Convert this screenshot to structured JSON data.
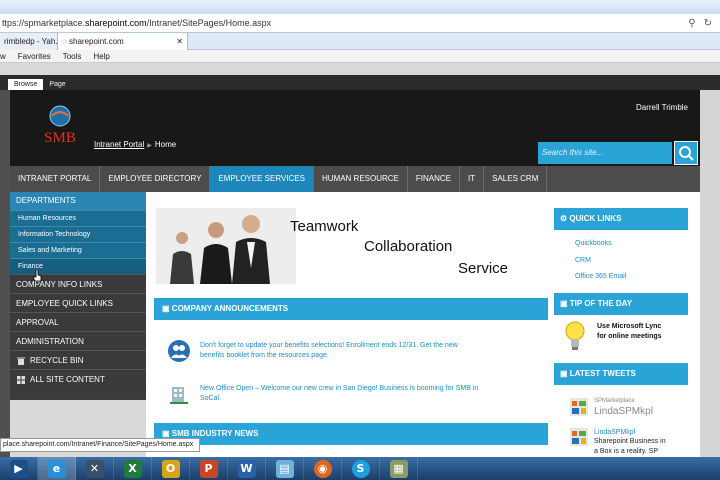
{
  "browser": {
    "url_prefix": "ttps://spmarketplace.",
    "url_domain": "sharepoint.com",
    "url_path": "/Intranet/SitePages/Home.aspx",
    "tabs": [
      {
        "label": "rimbledp - Yah..."
      },
      {
        "label": "sharepoint.com"
      }
    ],
    "menu": [
      "w",
      "Favorites",
      "Tools",
      "Help"
    ],
    "status_url": "place.sharepoint.com/Intranet/Finance/SitePages/Home.aspx"
  },
  "ribbon": {
    "tabs": [
      "Browse",
      "Page"
    ],
    "active": "Browse"
  },
  "header": {
    "user_name": "Darrell Trimble",
    "logo_text": "SMB",
    "breadcrumb": [
      "Intranet Portal",
      "Home"
    ],
    "search_placeholder": "Search this site..."
  },
  "top_nav": [
    {
      "label": "INTRANET PORTAL"
    },
    {
      "label": "EMPLOYEE DIRECTORY"
    },
    {
      "label": "EMPLOYEE SERVICES"
    },
    {
      "label": "HUMAN RESOURCE"
    },
    {
      "label": "FINANCE"
    },
    {
      "label": "IT"
    },
    {
      "label": "SALES CRM"
    }
  ],
  "left_nav": {
    "heading": "DEPARTMENTS",
    "departments": [
      "Human Resources",
      "Information Technology",
      "Sales and Marketing",
      "Finance"
    ],
    "items": [
      "COMPANY INFO LINKS",
      "EMPLOYEE QUICK LINKS",
      "APPROVAL",
      "ADMINISTRATION"
    ],
    "recycle_bin": "RECYCLE BIN",
    "all_site_content": "ALL SITE CONTENT"
  },
  "banner": {
    "line1": "Teamwork",
    "line2": "Collaboration",
    "line3": "Service"
  },
  "announcements": {
    "heading": "COMPANY ANNOUNCEMENTS",
    "items": [
      {
        "line1": "Don't forget to update your benefits selections! Enrollment ends 12/31. Get the new",
        "line2": "benefits booklet from the resources page."
      },
      {
        "line1": "New Office Open – Welcome our new crew in San Diego! Business is booming for SMB in",
        "line2": "SoCal."
      }
    ]
  },
  "industry_news": {
    "heading": "SMB INDUSTRY NEWS"
  },
  "quick_links": {
    "heading": "QUICK LINKS",
    "links": [
      "Quickbooks",
      "CRM",
      "Office 365 Email"
    ]
  },
  "tip_of_day": {
    "heading": "TIP OF THE DAY",
    "line1": "Use Microsoft Lync",
    "line2": "for online meetings"
  },
  "latest_tweets": {
    "heading": "LATEST TWEETS",
    "profile_label": "SPMarketplace",
    "profile_name": "LindaSPMkpl",
    "tweet_user": "LindaSPMkpl",
    "tweet_line1": "Sharepoint Business in",
    "tweet_line2": "a Box is a reality. SP"
  },
  "colors": {
    "accent": "#2aa3d6",
    "nav_active": "#1e86b9",
    "header_bg": "#181818",
    "left_nav_bg": "#3b3b3b"
  },
  "taskbar": [
    "start",
    "ie",
    "xsplit",
    "excel",
    "outlook",
    "powerpoint",
    "word",
    "notes",
    "firefox",
    "skype",
    "other"
  ]
}
